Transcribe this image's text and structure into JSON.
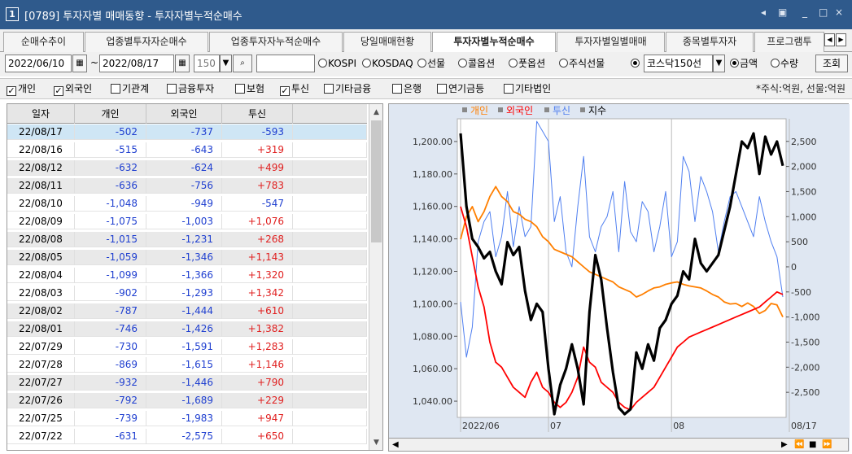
{
  "window": {
    "number": "1",
    "title": "[0789] 투자자별 매매동향 - 투자자별누적순매수",
    "controls": [
      "◂",
      "▣",
      "_",
      "□",
      "×"
    ]
  },
  "tabs": [
    {
      "label": "순매수추이",
      "active": false
    },
    {
      "label": "업종별투자자순매수",
      "active": false
    },
    {
      "label": "업종투자자누적순매수",
      "active": false
    },
    {
      "label": "당일매매현황",
      "active": false
    },
    {
      "label": "투자자별누적순매수",
      "active": true
    },
    {
      "label": "투자자별일별매매",
      "active": false
    },
    {
      "label": "종목별투자자",
      "active": false
    },
    {
      "label": "프로그램투",
      "active": false
    }
  ],
  "toolbar": {
    "start_date": "2022/06/10",
    "tilde": "~",
    "end_date": "2022/08/17",
    "count": "150",
    "radios": [
      {
        "label": "KOSPI",
        "on": false
      },
      {
        "label": "KOSDAQ",
        "on": false
      },
      {
        "label": "선물",
        "on": false
      },
      {
        "label": "콜옵션",
        "on": false
      },
      {
        "label": "풋옵션",
        "on": false
      },
      {
        "label": "주식선물",
        "on": true
      }
    ],
    "index_select": "코스닥150선",
    "mode_radios": [
      {
        "label": "금액",
        "on": true
      },
      {
        "label": "수량",
        "on": false
      }
    ],
    "query_button": "조회"
  },
  "filters": {
    "items": [
      {
        "label": "개인",
        "checked": true
      },
      {
        "label": "외국인",
        "checked": true
      },
      {
        "label": "기관계",
        "checked": false
      },
      {
        "label": "금융투자",
        "checked": false
      },
      {
        "label": "보험",
        "checked": false
      },
      {
        "label": "투신",
        "checked": true
      },
      {
        "label": "기타금융",
        "checked": false
      },
      {
        "label": "은행",
        "checked": false
      },
      {
        "label": "연기금등",
        "checked": false
      },
      {
        "label": "기타법인",
        "checked": false
      }
    ],
    "unit_note": "*주식:억원, 선물:억원"
  },
  "table": {
    "headers": [
      "일자",
      "개인",
      "외국인",
      "투신"
    ],
    "rows": [
      [
        "22/08/17",
        "-502",
        "-737",
        "-593"
      ],
      [
        "22/08/16",
        "-515",
        "-643",
        "+319"
      ],
      [
        "22/08/12",
        "-632",
        "-624",
        "+499"
      ],
      [
        "22/08/11",
        "-636",
        "-756",
        "+783"
      ],
      [
        "22/08/10",
        "-1,048",
        "-949",
        "-547"
      ],
      [
        "22/08/09",
        "-1,075",
        "-1,003",
        "+1,076"
      ],
      [
        "22/08/08",
        "-1,015",
        "-1,231",
        "+268"
      ],
      [
        "22/08/05",
        "-1,059",
        "-1,346",
        "+1,143"
      ],
      [
        "22/08/04",
        "-1,099",
        "-1,366",
        "+1,320"
      ],
      [
        "22/08/03",
        "-902",
        "-1,293",
        "+1,342"
      ],
      [
        "22/08/02",
        "-787",
        "-1,444",
        "+610"
      ],
      [
        "22/08/01",
        "-746",
        "-1,426",
        "+1,382"
      ],
      [
        "22/07/29",
        "-730",
        "-1,591",
        "+1,283"
      ],
      [
        "22/07/28",
        "-869",
        "-1,615",
        "+1,146"
      ],
      [
        "22/07/27",
        "-932",
        "-1,446",
        "+790"
      ],
      [
        "22/07/26",
        "-792",
        "-1,689",
        "+229"
      ],
      [
        "22/07/25",
        "-739",
        "-1,983",
        "+947"
      ],
      [
        "22/07/22",
        "-631",
        "-2,575",
        "+650"
      ]
    ]
  },
  "colors": {
    "individual": "#ff7f00",
    "foreign": "#ff0000",
    "trust": "#4f7ff0",
    "index": "#000000",
    "positive_text": "#e02020",
    "negative_text": "#1f3fd0"
  },
  "chart_data": {
    "type": "line",
    "legend": [
      "개인",
      "외국인",
      "투신",
      "지수"
    ],
    "x_labels": [
      "2022/06",
      "07",
      "08",
      "08/17"
    ],
    "left_axis": {
      "ticks": [
        "1,200.00",
        "1,180.00",
        "1,160.00",
        "1,140.00",
        "1,120.00",
        "1,100.00",
        "1,080.00",
        "1,060.00",
        "1,040.00"
      ],
      "range": [
        1030,
        1214
      ]
    },
    "right_axis": {
      "ticks": [
        "2,500",
        "2,000",
        "1,500",
        "1,000",
        "500",
        "0",
        "-500",
        "-1,000",
        "-1,500",
        "-2,000",
        "-2,500"
      ],
      "range": [
        -3000,
        2950
      ]
    },
    "series": [
      {
        "name": "지수",
        "axis": "left",
        "values": [
          1205,
          1160,
          1140,
          1135,
          1128,
          1132,
          1120,
          1112,
          1138,
          1130,
          1135,
          1108,
          1090,
          1100,
          1095,
          1060,
          1032,
          1050,
          1060,
          1075,
          1060,
          1038,
          1095,
          1130,
          1115,
          1085,
          1058,
          1036,
          1032,
          1035,
          1070,
          1060,
          1075,
          1065,
          1085,
          1090,
          1100,
          1105,
          1120,
          1115,
          1140,
          1125,
          1120,
          1125,
          1130,
          1145,
          1160,
          1180,
          1200,
          1196,
          1205,
          1180,
          1203,
          1192,
          1200,
          1185
        ]
      },
      {
        "name": "개인",
        "axis": "right",
        "values": [
          550,
          1000,
          1200,
          900,
          1100,
          1400,
          1600,
          1400,
          1300,
          1100,
          1050,
          950,
          900,
          800,
          600,
          500,
          350,
          300,
          250,
          200,
          100,
          0,
          -100,
          -150,
          -200,
          -250,
          -300,
          -400,
          -450,
          -500,
          -600,
          -550,
          -480,
          -420,
          -400,
          -350,
          -320,
          -300,
          -350,
          -380,
          -400,
          -420,
          -480,
          -550,
          -600,
          -700,
          -740,
          -730,
          -790,
          -720,
          -790,
          -930,
          -870,
          -730,
          -760,
          -1000
        ]
      },
      {
        "name": "외국인",
        "axis": "right",
        "values": [
          1200,
          800,
          200,
          -400,
          -800,
          -1500,
          -1900,
          -2000,
          -2200,
          -2400,
          -2500,
          -2600,
          -2300,
          -2100,
          -2400,
          -2500,
          -2700,
          -2800,
          -2700,
          -2500,
          -2200,
          -1600,
          -1900,
          -2000,
          -2300,
          -2400,
          -2500,
          -2700,
          -2800,
          -2850,
          -2700,
          -2600,
          -2500,
          -2400,
          -2200,
          -2000,
          -1800,
          -1600,
          -1500,
          -1400,
          -1350,
          -1300,
          -1250,
          -1200,
          -1150,
          -1100,
          -1050,
          -1000,
          -950,
          -900,
          -850,
          -800,
          -700,
          -600,
          -500,
          -550
        ]
      },
      {
        "name": "투신",
        "axis": "right",
        "values": [
          -700,
          -1800,
          -1200,
          500,
          900,
          1100,
          200,
          600,
          1500,
          400,
          1200,
          600,
          800,
          2900,
          2700,
          2500,
          900,
          1400,
          300,
          0,
          1200,
          2200,
          600,
          300,
          800,
          1000,
          1500,
          300,
          1700,
          700,
          500,
          1300,
          1100,
          300,
          800,
          1500,
          200,
          500,
          2200,
          1900,
          900,
          1800,
          1500,
          1100,
          300,
          900,
          1400,
          1500,
          1200,
          900,
          600,
          1400,
          900,
          500,
          200,
          -600
        ]
      }
    ]
  }
}
